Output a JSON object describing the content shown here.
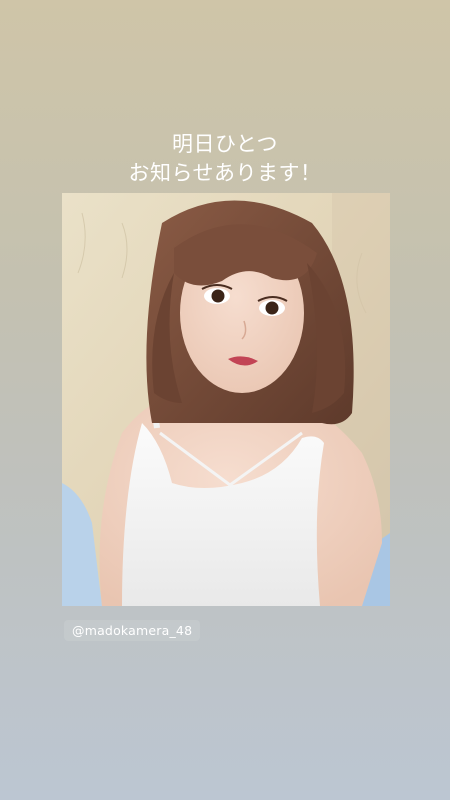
{
  "story": {
    "caption_line_1": "明日ひとつ",
    "caption_line_2": "お知らせあります！",
    "mention": "@madokamera_48"
  },
  "colors": {
    "background_top": "#cfc5a8",
    "background_bottom": "#bcc6d2",
    "text": "#ffffff"
  }
}
